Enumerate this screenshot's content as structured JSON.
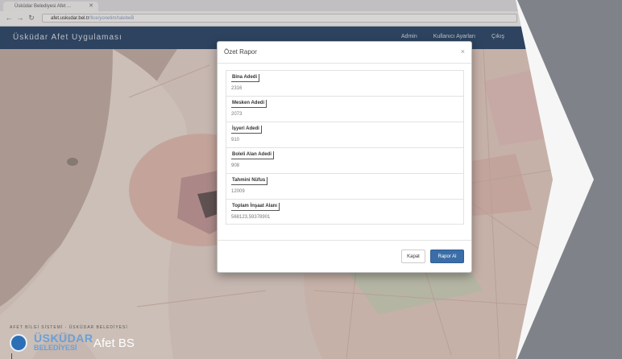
{
  "browser": {
    "tab_title": "Üsküdar Belediyesi Afet ...",
    "url_domain": "afet.uskudar.bel.tr",
    "url_path": "/Ilce/yonetim/talebeB"
  },
  "app": {
    "title": "Üsküdar Afet Uygulaması",
    "nav": [
      "Admin",
      "Kullanıcı Ayarları",
      "Çıkış"
    ]
  },
  "modal": {
    "title": "Özet Rapor",
    "close_symbol": "×",
    "fields": [
      {
        "label": "Bina Adedi",
        "value": "2316"
      },
      {
        "label": "Mesken Adedi",
        "value": "2073"
      },
      {
        "label": "İşyeri Adedi",
        "value": "910"
      },
      {
        "label": "Boleli Alan Adedi",
        "value": "908"
      },
      {
        "label": "Tahmini Nüfus",
        "value": "12009"
      },
      {
        "label": "Toplam İnşaat Alanı",
        "value": "568123,59378901"
      }
    ],
    "buttons": {
      "close": "Kapat",
      "primary": "Rapor Al"
    }
  },
  "footer": {
    "copyright": "AFET BİLGİ SİSTEMİ · ÜSKÜDAR BELEDİYESİ",
    "logo_line1": "ÜSKÜDAR",
    "logo_line2": "BELEDİYESİ",
    "product": "Afet BS"
  },
  "colors": {
    "appbar": "#2f4e6f",
    "primary_button": "#3b6ea8",
    "map_base": "#ead9cf"
  }
}
